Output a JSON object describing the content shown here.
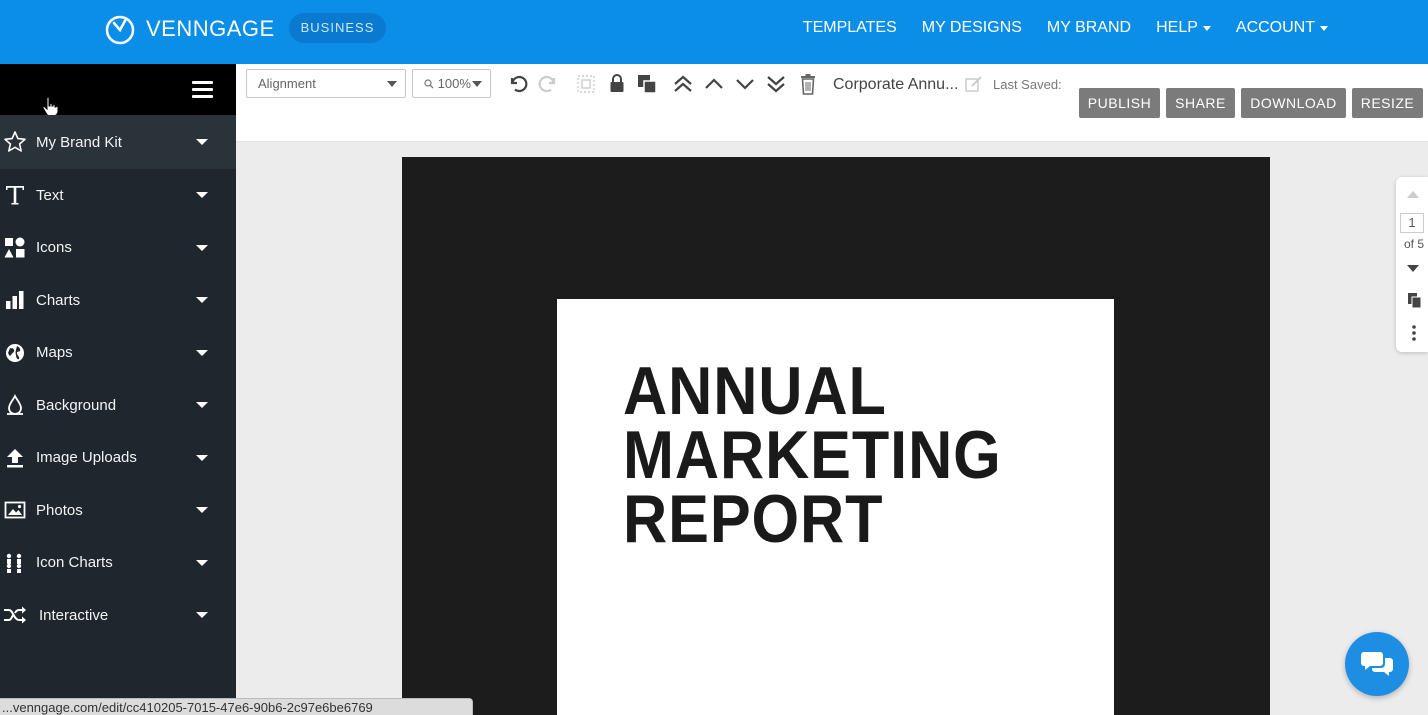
{
  "brand": {
    "name": "VENNGAGE",
    "badge": "BUSINESS"
  },
  "nav": [
    {
      "label": "TEMPLATES",
      "dropdown": false
    },
    {
      "label": "MY DESIGNS",
      "dropdown": false
    },
    {
      "label": "MY BRAND",
      "dropdown": false
    },
    {
      "label": "HELP",
      "dropdown": true
    },
    {
      "label": "ACCOUNT",
      "dropdown": true
    }
  ],
  "sidebar": {
    "items": [
      {
        "label": "My Brand Kit",
        "icon": "star-icon"
      },
      {
        "label": "Text",
        "icon": "text-icon"
      },
      {
        "label": "Icons",
        "icon": "shapes-icon"
      },
      {
        "label": "Charts",
        "icon": "bar-chart-icon"
      },
      {
        "label": "Maps",
        "icon": "globe-icon"
      },
      {
        "label": "Background",
        "icon": "droplet-icon"
      },
      {
        "label": "Image Uploads",
        "icon": "upload-icon"
      },
      {
        "label": "Photos",
        "icon": "photo-icon"
      },
      {
        "label": "Icon Charts",
        "icon": "icon-chart-icon"
      },
      {
        "label": "Interactive",
        "icon": "shuffle-icon"
      }
    ]
  },
  "toolbar": {
    "alignment_label": "Alignment",
    "zoom_label": "100%",
    "doc_title": "Corporate Annu...",
    "last_saved": "Last Saved:",
    "buttons": {
      "publish": "PUBLISH",
      "share": "SHARE",
      "download": "DOWNLOAD",
      "resize": "RESIZE"
    }
  },
  "canvas": {
    "title_lines": [
      "ANNUAL",
      "MARKETING",
      "REPORT"
    ]
  },
  "pagenav": {
    "current": "1",
    "of_text": "of 5"
  },
  "status_url": "...venngage.com/edit/cc410205-7015-47e6-90b6-2c97e6be6769",
  "colors": {
    "topbar": "#0b8ee8",
    "sidebar": "#1f262d",
    "button_gray": "#7b7b7b",
    "chat": "#1e8ee3"
  }
}
